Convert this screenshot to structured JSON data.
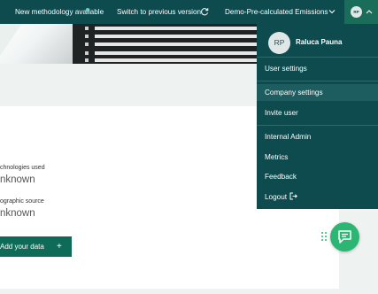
{
  "topbar": {
    "new_methodology": "New methodology available",
    "switch_previous": "Switch to previous version",
    "emissions_selector": "Demo-Pre-calculated Emissions",
    "avatar_initials": "RP"
  },
  "content": {
    "tech_label": "chnologies used",
    "tech_value": "nknown",
    "geo_label": "ographic source",
    "geo_value": "nknown",
    "add_button": "Add your data",
    "add_plus": "+"
  },
  "dropdown": {
    "avatar_initials": "RP",
    "user_name": "Raluca Pauna",
    "items": [
      "User settings",
      "Company settings",
      "Invite user",
      "Internal Admin",
      "Metrics",
      "Feedback",
      "Logout"
    ]
  },
  "colors": {
    "topbar": "#0e4b4f",
    "dropdown": "#0e4b4f",
    "accent_green": "#2bb673",
    "button": "#0e6b58"
  },
  "icons": [
    "refresh-icon",
    "chevron-down-icon",
    "chevron-up-icon",
    "logout-icon",
    "chat-icon",
    "drag-handle-icon",
    "plus-icon"
  ]
}
